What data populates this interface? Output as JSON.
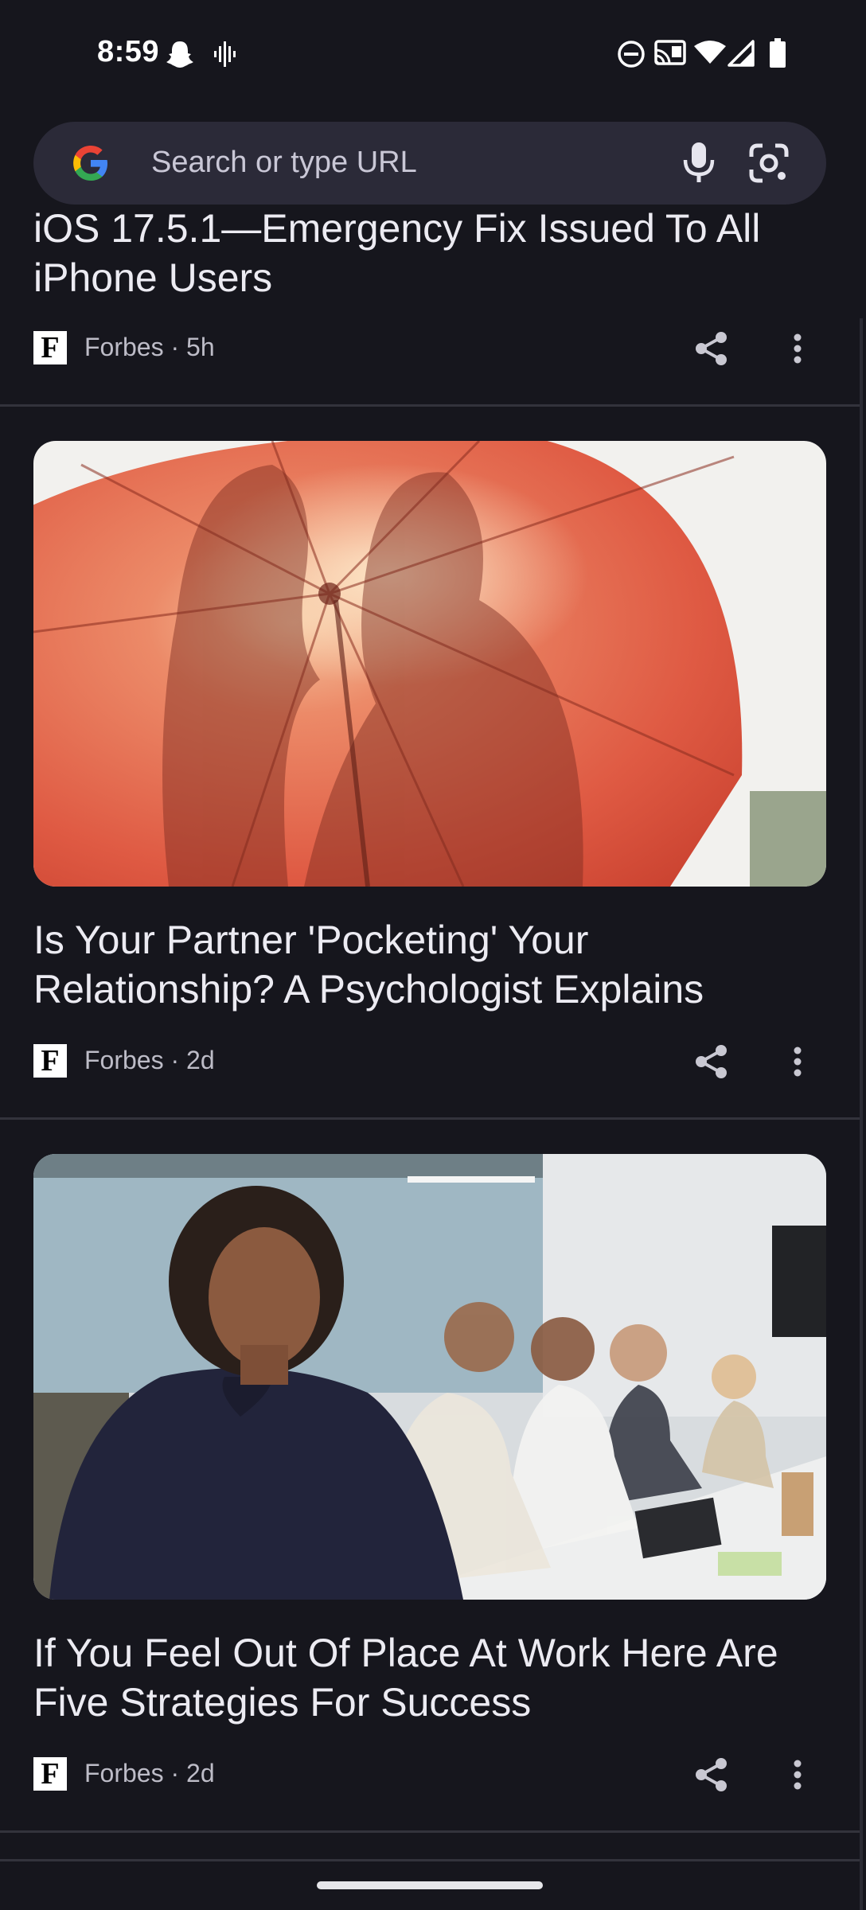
{
  "status_bar": {
    "time": "8:59",
    "left_icons": [
      "snapchat-icon",
      "voice-wave-icon"
    ],
    "right_icons": [
      "do-not-disturb-icon",
      "cast-icon",
      "wifi-icon",
      "cellular-signal-icon",
      "battery-icon"
    ]
  },
  "search": {
    "placeholder": "Search or type URL",
    "icons": [
      "google-logo",
      "microphone-icon",
      "google-lens-icon"
    ]
  },
  "articles": [
    {
      "title_line1": "iOS 17.5.1—Emergency Fix Issued To All",
      "title_line2": "iPhone Users",
      "source": "Forbes · 5h",
      "logo_letter": "F"
    },
    {
      "title_line1": "Is Your Partner 'Pocketing' Your",
      "title_line2": "Relationship? A Psychologist Explains",
      "source": "Forbes · 2d",
      "logo_letter": "F",
      "image": "couple-silhouette-behind-red-umbrella"
    },
    {
      "title_line1": "If You Feel Out Of Place At Work Here Are",
      "title_line2": "Five Strategies For Success",
      "source": "Forbes · 2d",
      "logo_letter": "F",
      "image": "woman-in-office-meeting-with-colleagues"
    }
  ],
  "colors": {
    "background": "#16161d",
    "search_bar": "#2b2a38",
    "divider": "#33333c",
    "umbrella_red": "#e0533c"
  }
}
